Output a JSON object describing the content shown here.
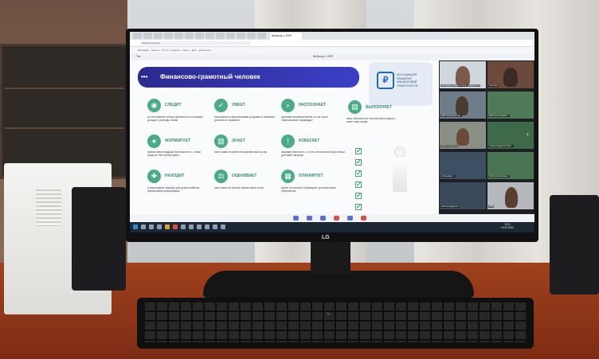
{
  "browser": {
    "active_tab_label": "Вебинар с ПФР",
    "address": "webinar.ru/room/...",
    "bookmarks": "Вебинары · Каналы · Почта · Сервисы · Карты · Диск · Документы"
  },
  "conference": {
    "app_label": "Ток",
    "title": "Вебинар с ПФР"
  },
  "slide": {
    "title": "Финансово-грамотный человек",
    "logo_glyph": "₽",
    "association": "АССОЦИАЦИЯ РАЗВИТИЯ ФИНАНСОВОЙ ГРАМОТНОСТИ",
    "items": [
      {
        "title": "СЛЕДИТ",
        "desc": "за состоянием личных финансов и планирует доходы и расходы семьи",
        "icon": "eye-icon"
      },
      {
        "title": "УМЕЕТ",
        "desc": "пользоваться финансовыми услугами и понимает условия их оказания",
        "icon": "thumb-icon"
      },
      {
        "title": "РАСПОЗНАЕТ",
        "desc": "признаки мошенничества, в том числе «финансовые пирамиды»",
        "icon": "magnifier-icon"
      },
      {
        "title": "ВЫПОЛНЯЕТ",
        "desc": "свои обязанности налогоплательщика и знает свои права",
        "icon": "document-icon"
      },
      {
        "title": "ФОРМИРУЕТ",
        "desc": "финансовую подушку безопасности – запас средств «на черный день»",
        "icon": "piggy-bank-icon"
      },
      {
        "title": "ЗНАЕТ",
        "desc": "свои права потребителя финансовых услуг",
        "icon": "book-icon"
      },
      {
        "title": "ИЗБЕГАЕТ",
        "desc": "закредитованности, то есть непосильной для семьи долговой нагрузки",
        "icon": "warning-icon"
      },
      {
        "title": "НАХОДИТ",
        "desc": "и анализирует важную для домохозяйства финансовую информацию",
        "icon": "puzzle-icon"
      },
      {
        "title": "ОЦЕНИВАЕТ",
        "desc": "свои риски на рынках финансовых услуг",
        "icon": "scales-icon"
      },
      {
        "title": "ПЛАНИРУЕТ",
        "desc": "жизнь на пенсии и формирует долгосрочные сбережения",
        "icon": "calendar-icon"
      }
    ],
    "page_number": "4"
  },
  "participants": [
    {
      "label": "Ассоциация развития фин. грамотности"
    },
    {
      "label": "Участник"
    },
    {
      "label": "ПФР Калужская обл."
    },
    {
      "label": "Библиотека финан..."
    },
    {
      "label": "Ирина Сидорова"
    },
    {
      "label": "Танина Людмила Павл..."
    },
    {
      "label": "Ассоциация ..."
    },
    {
      "label": "Библиотека финан..."
    },
    {
      "label": "Наталья Дудкина"
    },
    {
      "label": "ЛМК"
    }
  ],
  "monitor": {
    "brand": "LG"
  },
  "keyboard": {
    "brand": "hp"
  },
  "taskbar": {
    "time": "13:11",
    "date": "16.06.2021"
  }
}
